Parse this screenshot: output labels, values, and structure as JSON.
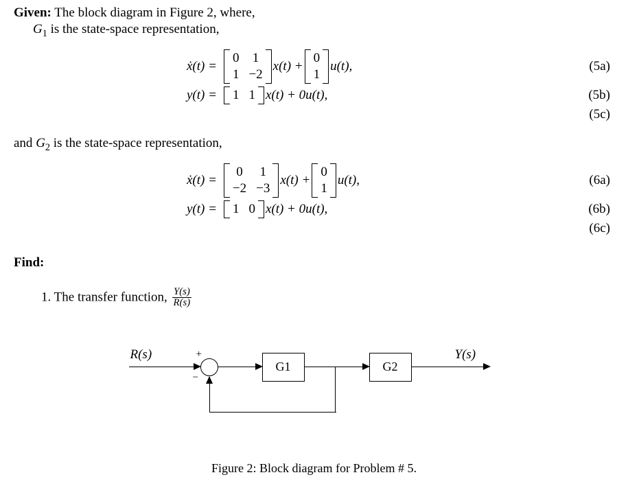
{
  "text": {
    "given_label": "Given:",
    "given_rest": " The block diagram in Figure 2, where,",
    "g1_line_a": "G",
    "g1_sub": "1",
    "g1_line_b": " is the state-space representation,",
    "and_label_a": "and ",
    "g2_a": "G",
    "g2_sub": "2",
    "and_label_b": " is the state-space representation,",
    "find_label": "Find:",
    "enum1_num": "1.",
    "enum1_text": "  The transfer function, ",
    "frac_num": "Y(s)",
    "frac_den": "R(s)",
    "caption": "Figure 2: Block diagram for Problem # 5."
  },
  "eq5a": {
    "lhs": "ẋ(t) =",
    "A": [
      [
        "0",
        "1"
      ],
      [
        "1",
        "−2"
      ]
    ],
    "mid1": "x(t) +",
    "B": [
      [
        "0"
      ],
      [
        "1"
      ]
    ],
    "mid2": "u(t),",
    "num": "(5a)"
  },
  "eq5b": {
    "lhs": "y(t) =",
    "C": [
      "1",
      "1"
    ],
    "mid": "x(t) + 0u(t),",
    "num": "(5b)"
  },
  "eq5c": {
    "num": "(5c)"
  },
  "eq6a": {
    "lhs": "ẋ(t) =",
    "A": [
      [
        "0",
        "1"
      ],
      [
        "−2",
        "−3"
      ]
    ],
    "mid1": "x(t) +",
    "B": [
      [
        "0"
      ],
      [
        "1"
      ]
    ],
    "mid2": "u(t),",
    "num": "(6a)"
  },
  "eq6b": {
    "lhs": "y(t) =",
    "C": [
      "1",
      "0"
    ],
    "mid": "x(t) + 0u(t),",
    "num": "(6b)"
  },
  "eq6c": {
    "num": "(6c)"
  },
  "diagram": {
    "R": "R(s)",
    "G1": "G1",
    "G2": "G2",
    "Y": "Y(s)",
    "plus": "+",
    "minus": "−"
  }
}
